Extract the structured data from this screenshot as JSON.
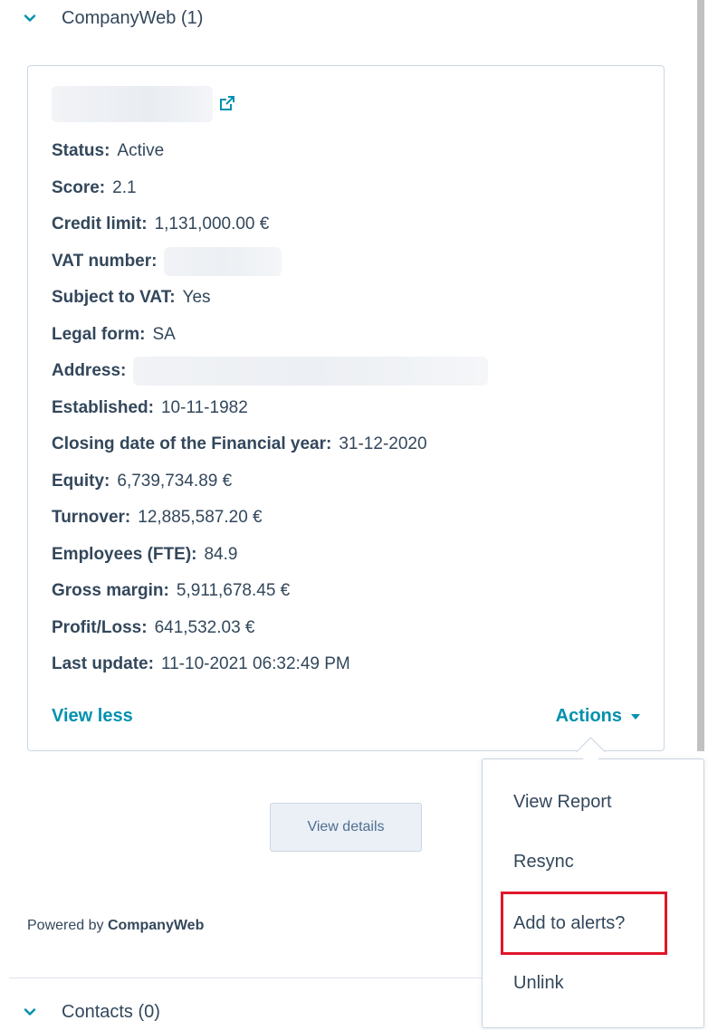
{
  "sections": {
    "companyweb_title": "CompanyWeb (1)",
    "contacts_title": "Contacts (0)"
  },
  "card": {
    "fields": [
      {
        "label": "Status:",
        "value": "Active"
      },
      {
        "label": "Score:",
        "value": "2.1"
      },
      {
        "label": "Credit limit:",
        "value": "1,131,000.00 €"
      },
      {
        "label": "VAT number:",
        "value": ""
      },
      {
        "label": "Subject to VAT:",
        "value": "Yes"
      },
      {
        "label": "Legal form:",
        "value": "SA"
      },
      {
        "label": "Address:",
        "value": ""
      },
      {
        "label": "Established:",
        "value": "10-11-1982"
      },
      {
        "label": "Closing date of the Financial year:",
        "value": "31-12-2020"
      },
      {
        "label": "Equity:",
        "value": "6,739,734.89 €"
      },
      {
        "label": "Turnover:",
        "value": "12,885,587.20 €"
      },
      {
        "label": "Employees (FTE):",
        "value": "84.9"
      },
      {
        "label": "Gross margin:",
        "value": "5,911,678.45 €"
      },
      {
        "label": "Profit/Loss:",
        "value": "641,532.03 €"
      },
      {
        "label": "Last update:",
        "value": "11-10-2021 06:32:49 PM"
      }
    ],
    "view_less": "View less",
    "actions": "Actions"
  },
  "view_details": "View details",
  "powered_by": {
    "prefix": "Powered by",
    "brand": "CompanyWeb"
  },
  "actions_menu": {
    "items": [
      "View Report",
      "Resync",
      "Add to alerts?",
      "Unlink"
    ]
  },
  "colors": {
    "accent": "#0091ae",
    "highlight": "#e0162b",
    "text": "#33475b"
  },
  "icons": {
    "collapse": "chevron-down-icon",
    "external": "external-link-icon",
    "caret": "caret-down-icon"
  }
}
